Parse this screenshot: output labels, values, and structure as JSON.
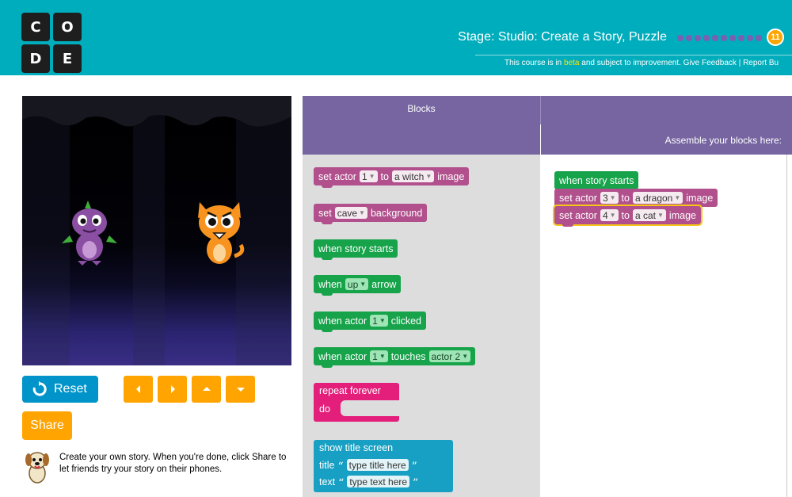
{
  "header": {
    "logo_letters": [
      "C",
      "O",
      "D",
      "E"
    ],
    "stage_title": "Stage: Studio: Create a Story, Puzzle",
    "stage_progress_dots": 10,
    "stage_number": "11",
    "beta_prefix": "This course is in ",
    "beta_word": "beta",
    "beta_suffix": " and subject to improvement. Give Feedback | Report Bu"
  },
  "controls": {
    "reset_label": "Reset",
    "share_label": "Share",
    "arrows": [
      "left-arrow-icon",
      "right-arrow-icon",
      "up-arrow-icon",
      "down-arrow-icon"
    ]
  },
  "instructions": {
    "text": "Create your own story. When you're done, click Share to let friends try your story on their phones."
  },
  "toolbox": {
    "title": "Blocks",
    "blocks": {
      "set_actor": {
        "pre": "set actor",
        "field1": "1",
        "mid": "to",
        "field2": "a witch",
        "post": "image"
      },
      "set_bg": {
        "pre": "set",
        "field1": "cave",
        "post": "background"
      },
      "when_story_starts": {
        "label": "when story starts"
      },
      "when_arrow": {
        "pre": "when",
        "field1": "up",
        "post": "arrow"
      },
      "when_clicked": {
        "pre": "when actor",
        "field1": "1",
        "post": "clicked"
      },
      "when_touches": {
        "pre": "when actor",
        "field1": "1",
        "mid": "touches",
        "field2": "actor 2"
      },
      "repeat_forever": {
        "line1": "repeat forever",
        "line2": "do"
      },
      "show_title": {
        "line1": "show title screen",
        "title_label": "title",
        "title_value": "type title here",
        "text_label": "text",
        "text_value": "type text here",
        "open_quote": "“",
        "close_quote": "”"
      }
    }
  },
  "workspace": {
    "title": "Assemble your blocks here:",
    "blocks": {
      "when_story_starts": {
        "label": "when story starts"
      },
      "set_actor_a": {
        "pre": "set actor",
        "field1": "3",
        "mid": "to",
        "field2": "a dragon",
        "post": "image"
      },
      "set_actor_b": {
        "pre": "set actor",
        "field1": "4",
        "mid": "to",
        "field2": "a cat",
        "post": "image"
      }
    }
  },
  "colors": {
    "header_bg": "#00adbc",
    "panel_header": "#7665a0",
    "reset_blue": "#0094ca",
    "orange": "#ffa400",
    "block_pink": "#b1508c",
    "block_green": "#16a34a",
    "block_magenta": "#e31f7b",
    "block_teal": "#17a0c3"
  }
}
